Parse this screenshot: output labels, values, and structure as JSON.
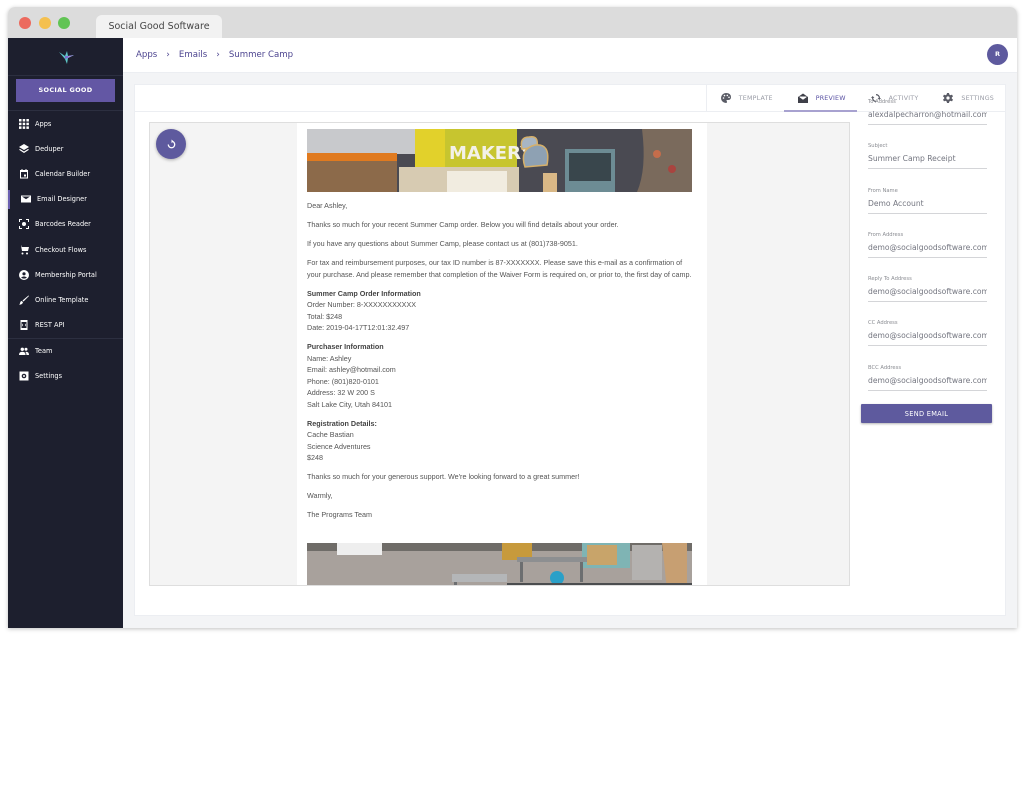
{
  "browser": {
    "tab_title": "Social Good Software"
  },
  "sidebar": {
    "org_button": "SOCIAL GOOD",
    "items": [
      {
        "label": "Apps",
        "icon": "grid-icon"
      },
      {
        "label": "Deduper",
        "icon": "layers-icon"
      },
      {
        "label": "Calendar Builder",
        "icon": "calendar-icon"
      },
      {
        "label": "Email Designer",
        "icon": "email-icon",
        "active": true
      },
      {
        "label": "Barcodes Reader",
        "icon": "scan-icon"
      },
      {
        "label": "Checkout Flows",
        "icon": "cart-icon"
      },
      {
        "label": "Membership Portal",
        "icon": "account-icon"
      },
      {
        "label": "Online Template",
        "icon": "brush-icon"
      },
      {
        "label": "REST API",
        "icon": "api-icon"
      },
      {
        "label": "Team",
        "icon": "team-icon"
      },
      {
        "label": "Settings",
        "icon": "settings-box-icon"
      }
    ]
  },
  "breadcrumb": [
    "Apps",
    "Emails",
    "Summer Camp"
  ],
  "user": {
    "avatar_initial": "R"
  },
  "tabs": [
    {
      "label": "TEMPLATE",
      "icon": "palette-icon"
    },
    {
      "label": "PREVIEW",
      "icon": "envelope-open-icon",
      "active": true
    },
    {
      "label": "ACTIVITY",
      "icon": "sync-icon"
    },
    {
      "label": "SETTINGS",
      "icon": "gear-icon"
    }
  ],
  "email": {
    "greeting": "Dear Ashley,",
    "intro": "Thanks so much for your recent Summer Camp order. Below you will find details about your order.",
    "questions": "If you have any questions about Summer Camp, please contact us at (801)738-9051.",
    "tax": "For tax and reimbursement purposes, our tax ID number is 87-XXXXXXX. Please save this e-mail as a confirmation of your purchase. And please remember that completion of the Waiver Form is required on, or prior to, the first day of camp.",
    "order": {
      "heading": "Summer Camp Order Information",
      "lines": [
        "Order Number: 8-XXXXXXXXXXX",
        "Total: $248",
        "Date: 2019-04-17T12:01:32.497"
      ]
    },
    "purchaser": {
      "heading": "Purchaser Information",
      "lines": [
        "Name: Ashley",
        "Email: ashley@hotmail.com",
        "Phone: (801)820-0101",
        "Address: 32 W 200 S",
        "Salt Lake City, Utah 84101"
      ]
    },
    "registration": {
      "heading": "Registration Details:",
      "lines": [
        "Cache Bastian",
        "Science Adventures",
        "$248"
      ]
    },
    "closing": "Thanks so much for your generous support. We're looking forward to a great summer!",
    "signoff": "Warmly,",
    "signature": "The Programs Team"
  },
  "form": {
    "fields": [
      {
        "label": "To Address",
        "value": "alexdalpecharron@hotmail.com"
      },
      {
        "label": "Subject",
        "value": "Summer Camp Receipt"
      },
      {
        "label": "From Name",
        "value": "Demo Account"
      },
      {
        "label": "From Address",
        "value": "demo@socialgoodsoftware.com"
      },
      {
        "label": "Reply To Address",
        "value": "demo@socialgoodsoftware.com"
      },
      {
        "label": "CC Address",
        "value": "demo@socialgoodsoftware.com"
      },
      {
        "label": "BCC Address",
        "value": "demo@socialgoodsoftware.com"
      }
    ],
    "send_button": "SEND EMAIL"
  },
  "colors": {
    "brand": "#5e5a9e",
    "sidebar_bg": "#1d1f2e",
    "breadcrumb": "#4d4590"
  }
}
